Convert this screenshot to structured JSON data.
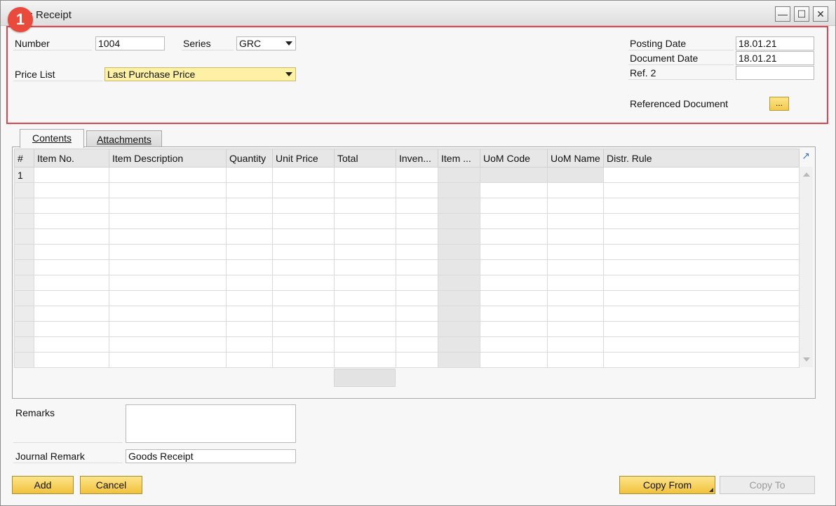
{
  "window": {
    "title": "ds Receipt",
    "badge": "1",
    "buttons": {
      "minimize": "—",
      "maximize": "☐",
      "close": "✕"
    }
  },
  "header": {
    "number_label": "Number",
    "number_value": "1004",
    "series_label": "Series",
    "series_value": "GRC",
    "price_list_label": "Price List",
    "price_list_value": "Last Purchase Price",
    "posting_date_label": "Posting Date",
    "posting_date_value": "18.01.21",
    "document_date_label": "Document Date",
    "document_date_value": "18.01.21",
    "ref2_label": "Ref. 2",
    "ref2_value": "",
    "referenced_document_label": "Referenced Document",
    "referenced_document_button": "..."
  },
  "tabs": [
    {
      "label": "Contents",
      "active": true
    },
    {
      "label": "Attachments",
      "active": false
    }
  ],
  "grid": {
    "columns": [
      "#",
      "Item No.",
      "Item Description",
      "Quantity",
      "Unit Price",
      "Total",
      "Inven...",
      "Item ...",
      "UoM Code",
      "UoM Name",
      "Distr. Rule"
    ],
    "first_row_number": "1",
    "expand_icon": "↗"
  },
  "footer": {
    "remarks_label": "Remarks",
    "remarks_value": "",
    "journal_remark_label": "Journal Remark",
    "journal_remark_value": "Goods Receipt"
  },
  "buttons": {
    "add": "Add",
    "cancel": "Cancel",
    "copy_from": "Copy From",
    "copy_to": "Copy To"
  },
  "colors": {
    "highlight": "#e4424d",
    "badge": "#ea4a3c",
    "button_yellow": "#f3c94a",
    "field_yellow": "#fdf1a6"
  }
}
